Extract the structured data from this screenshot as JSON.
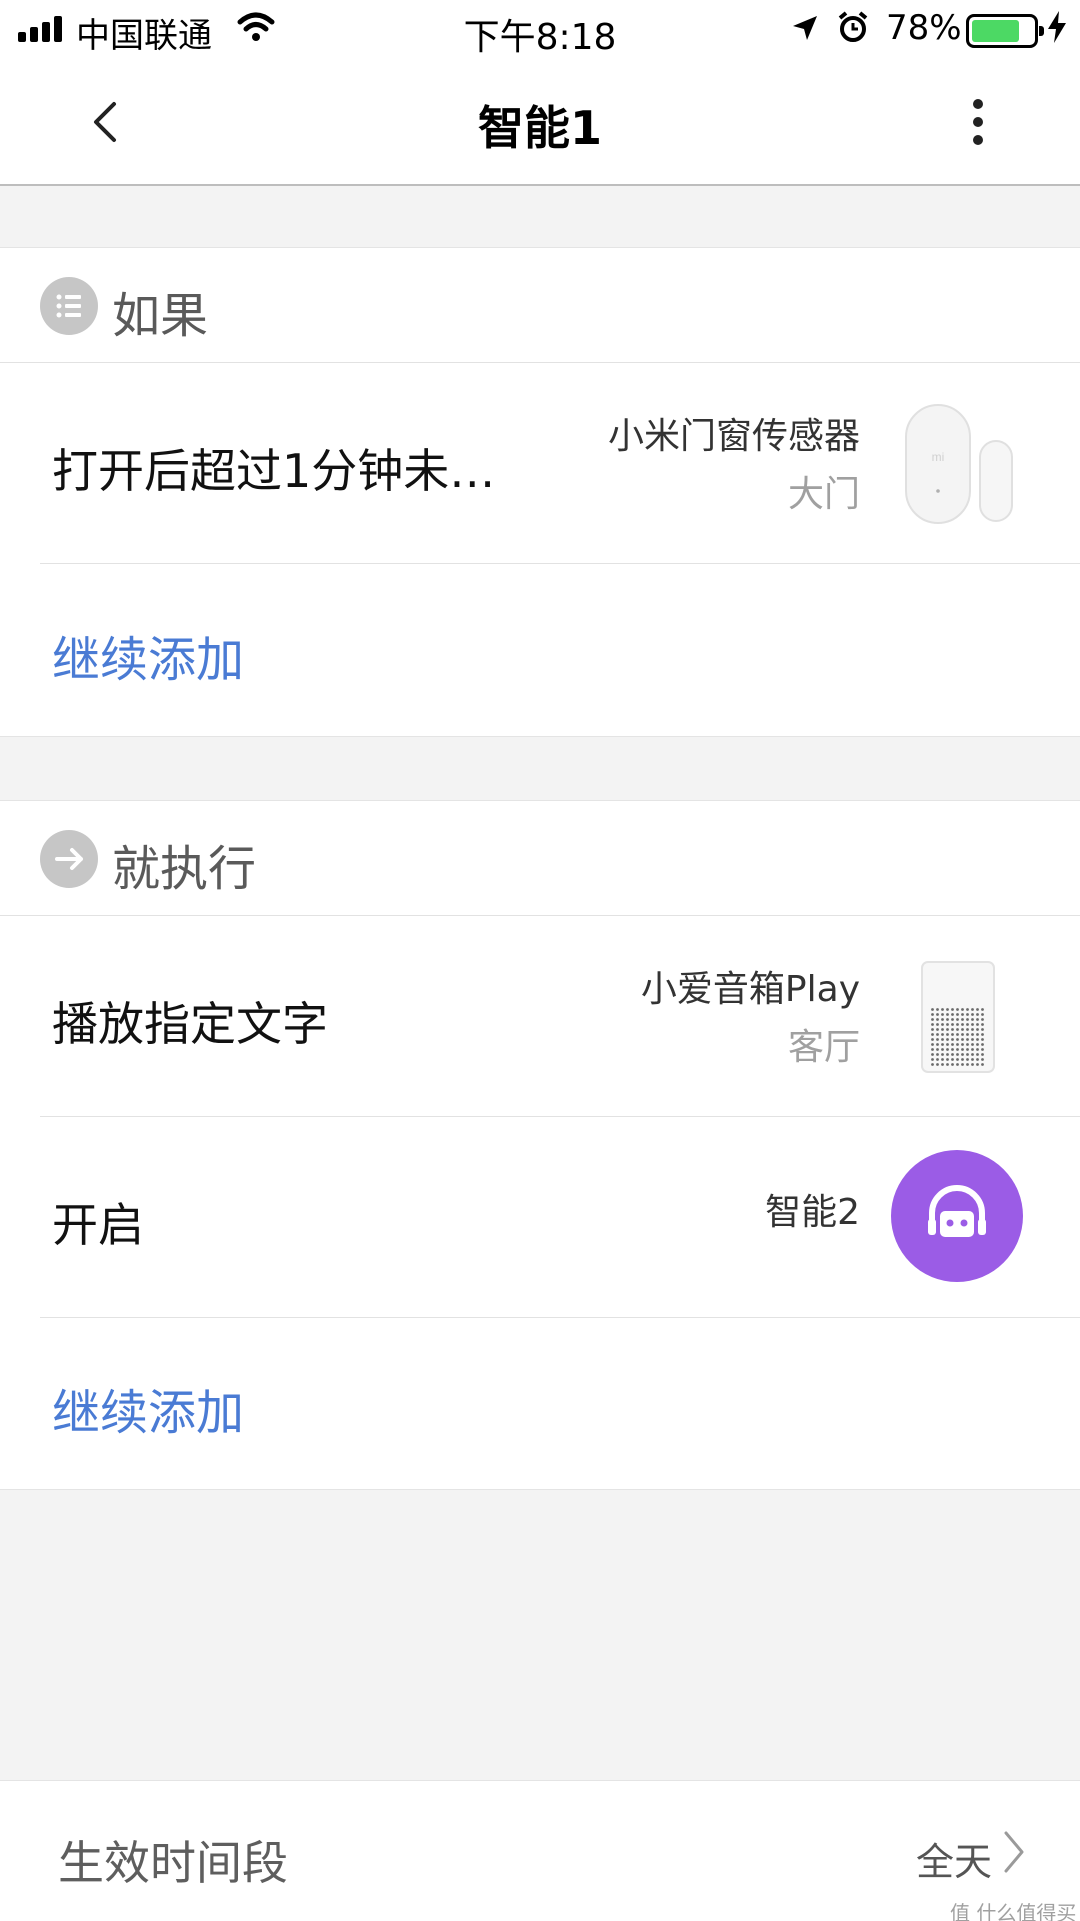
{
  "status_bar": {
    "carrier": "中国联通",
    "time": "下午8:18",
    "battery_percent": "78%",
    "battery_level": 0.78
  },
  "nav": {
    "title": "智能1"
  },
  "if_section": {
    "header": "如果",
    "condition": {
      "text": "打开后超过1分钟未…",
      "device_name": "小米门窗传感器",
      "device_room": "大门"
    },
    "add_label": "继续添加"
  },
  "then_section": {
    "header": "就执行",
    "actions": [
      {
        "text": "播放指定文字",
        "device_name": "小爱音箱Play",
        "device_room": "客厅"
      },
      {
        "text": "开启",
        "device_name": "智能2"
      }
    ],
    "add_label": "继续添加"
  },
  "footer": {
    "label": "生效时间段",
    "value": "全天",
    "watermark": "值 什么值得买"
  },
  "colors": {
    "link": "#4a7bd4",
    "scene_icon_bg": "#9b5ce6",
    "battery": "#4cd964"
  }
}
